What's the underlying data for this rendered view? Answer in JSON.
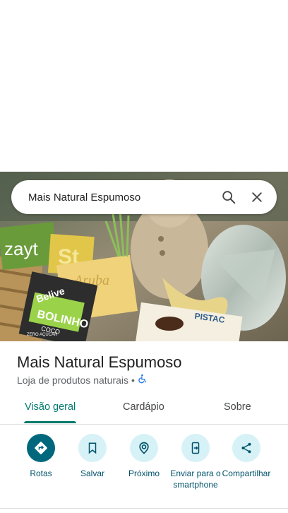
{
  "search": {
    "query": "Mais Natural Espumoso"
  },
  "place": {
    "name": "Mais Natural Espumoso",
    "category": "Loja de produtos naturais",
    "separator": "•",
    "accessibility_icon": "wheelchair-icon"
  },
  "photo": {
    "labels": [
      "zayt",
      "St",
      "Aruba",
      "Belive",
      "BOLINHO",
      "COCO",
      "ZERO AÇÚCAR",
      "PISTAC"
    ]
  },
  "tabs": [
    {
      "label": "Visão geral",
      "active": true
    },
    {
      "label": "Cardápio",
      "active": false
    },
    {
      "label": "Sobre",
      "active": false
    }
  ],
  "actions": [
    {
      "label": "Rotas",
      "icon": "directions-icon"
    },
    {
      "label": "Salvar",
      "icon": "bookmark-icon"
    },
    {
      "label": "Próximo",
      "icon": "nearby-icon"
    },
    {
      "label": "Enviar para o smartphone",
      "icon": "send-to-phone-icon"
    },
    {
      "label": "Compartilhar",
      "icon": "share-icon"
    }
  ],
  "colors": {
    "accent": "#00796b",
    "action_bg": "#d6f2f7",
    "primary_action": "#00677d"
  }
}
